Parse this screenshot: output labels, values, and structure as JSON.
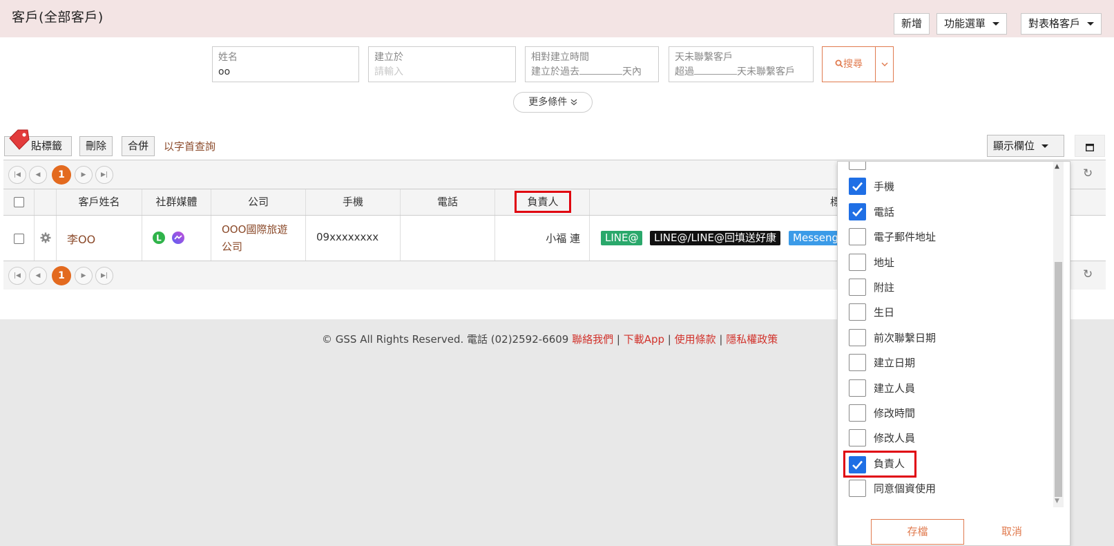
{
  "header": {
    "title": "客戶(全部客戶)",
    "add_label": "新增",
    "func_menu_label": "功能選單",
    "table_label": "對表格客戶"
  },
  "filters": {
    "name_label": "姓名",
    "name_value": "oo",
    "created_label": "建立於",
    "created_placeholder": "請輸入",
    "relative_label": "相對建立時間",
    "relative_prefix": "建立於過去",
    "relative_suffix": "天內",
    "nocontact_label": "天未聯繫客戶",
    "nocontact_prefix": "超過",
    "nocontact_suffix": "天未聯繫客戶",
    "search_label": "搜尋",
    "more_label": "更多條件"
  },
  "toolbar": {
    "tag_label": "貼標籤",
    "delete_label": "刪除",
    "merge_label": "合併",
    "az_label": "以字首查詢",
    "columns_label": "顯示欄位"
  },
  "pager": {
    "current_page": "1"
  },
  "table": {
    "columns": [
      "客戶姓名",
      "社群媒體",
      "公司",
      "手機",
      "電話",
      "負責人",
      "標"
    ],
    "row": {
      "name": "李OO",
      "company_line1": "OOO國際旅遊",
      "company_line2": "公司",
      "mobile": "09xxxxxxxx",
      "phone": "",
      "owner": "小福 連",
      "tags": [
        "LINE@",
        "LINE@/LINE@回填送好康",
        "Messeng"
      ]
    }
  },
  "footer": {
    "copyright": "© GSS All Rights Reserved. 電話 (02)2592-6609",
    "contact": "聯絡我們",
    "app": "下載App",
    "terms": "使用條款",
    "privacy": "隱私權政策"
  },
  "chooser": {
    "options": [
      {
        "label": "",
        "checked": false
      },
      {
        "label": "手機",
        "checked": true
      },
      {
        "label": "電話",
        "checked": true
      },
      {
        "label": "電子郵件地址",
        "checked": false
      },
      {
        "label": "地址",
        "checked": false
      },
      {
        "label": "附註",
        "checked": false
      },
      {
        "label": "生日",
        "checked": false
      },
      {
        "label": "前次聯繫日期",
        "checked": false
      },
      {
        "label": "建立日期",
        "checked": false
      },
      {
        "label": "建立人員",
        "checked": false
      },
      {
        "label": "修改時間",
        "checked": false
      },
      {
        "label": "修改人員",
        "checked": false
      },
      {
        "label": "負責人",
        "checked": true
      },
      {
        "label": "同意個資使用",
        "checked": false
      }
    ],
    "save_label": "存檔",
    "cancel_label": "取消"
  },
  "colors": {
    "accent": "#e07a4e",
    "page_current": "#e36a1f",
    "line_tag": "#2aa86b",
    "black_tag": "#111111",
    "messenger_tag": "#3b9be8",
    "highlight": "#e0000f",
    "checked": "#1f6fe5"
  }
}
